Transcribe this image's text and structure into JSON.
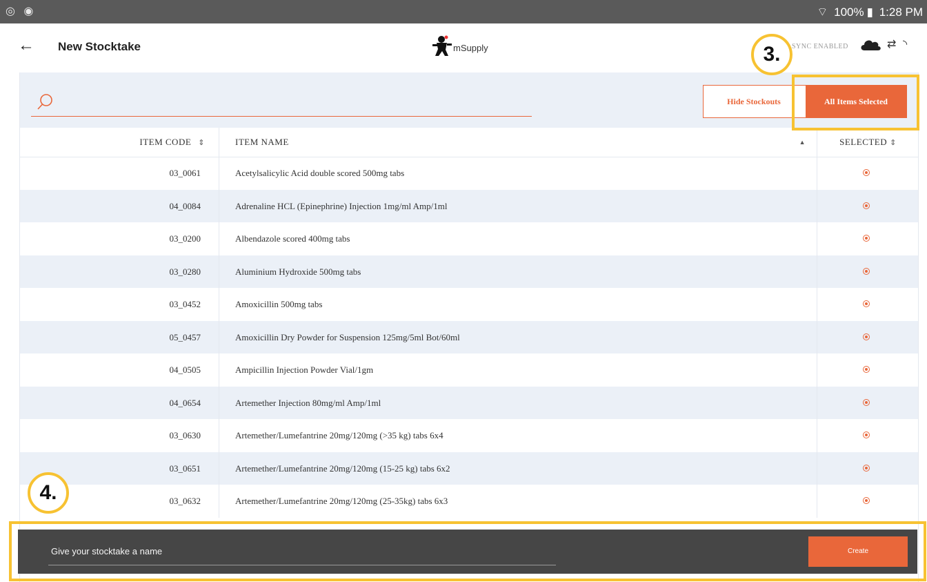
{
  "status_bar": {
    "left_icons": "◎ ◉",
    "wifi": "⌔",
    "battery_percent": "100%",
    "battery_glyph": "▮",
    "time": "1:28 PM"
  },
  "header": {
    "back_glyph": "←",
    "title": "New Stocktake",
    "logo_text": "mSupply",
    "sync_status": "SYNC ENABLED",
    "transfer_glyph": "⇄",
    "signal_glyph": "◝"
  },
  "toolbar": {
    "search_value": "",
    "toggle_left": "Hide Stockouts",
    "toggle_right": "All Items Selected"
  },
  "table": {
    "columns": {
      "code": "ITEM CODE",
      "name": "ITEM NAME",
      "selected": "SELECTED"
    },
    "sort_glyph": "⇕",
    "sort_up_glyph": "▲",
    "rows": [
      {
        "code": "03_0061",
        "name": "Acetylsalicylic Acid double scored 500mg tabs",
        "selected": true
      },
      {
        "code": "04_0084",
        "name": "Adrenaline HCL (Epinephrine) Injection 1mg/ml Amp/1ml",
        "selected": true
      },
      {
        "code": "03_0200",
        "name": "Albendazole scored 400mg tabs",
        "selected": true
      },
      {
        "code": "03_0280",
        "name": "Aluminium Hydroxide 500mg tabs",
        "selected": true
      },
      {
        "code": "03_0452",
        "name": "Amoxicillin 500mg tabs",
        "selected": true
      },
      {
        "code": "05_0457",
        "name": "Amoxicillin Dry Powder for Suspension 125mg/5ml Bot/60ml",
        "selected": true
      },
      {
        "code": "04_0505",
        "name": "Ampicillin Injection Powder Vial/1gm",
        "selected": true
      },
      {
        "code": "04_0654",
        "name": "Artemether Injection 80mg/ml Amp/1ml",
        "selected": true
      },
      {
        "code": "03_0630",
        "name": "Artemether/Lumefantrine 20mg/120mg (>35 kg) tabs 6x4",
        "selected": true
      },
      {
        "code": "03_0651",
        "name": "Artemether/Lumefantrine 20mg/120mg (15-25 kg) tabs 6x2",
        "selected": true
      },
      {
        "code": "03_0632",
        "name": "Artemether/Lumefantrine 20mg/120mg (25-35kg) tabs 6x3",
        "selected": true
      }
    ]
  },
  "footer": {
    "name_placeholder": "Give your stocktake a name",
    "create_label": "Create"
  },
  "annotations": {
    "step_3": "3.",
    "step_4": "4."
  },
  "colors": {
    "accent": "#e9673a",
    "highlight": "#f7c232",
    "row_alt": "#ebf0f7",
    "footer_bg": "#464646"
  }
}
